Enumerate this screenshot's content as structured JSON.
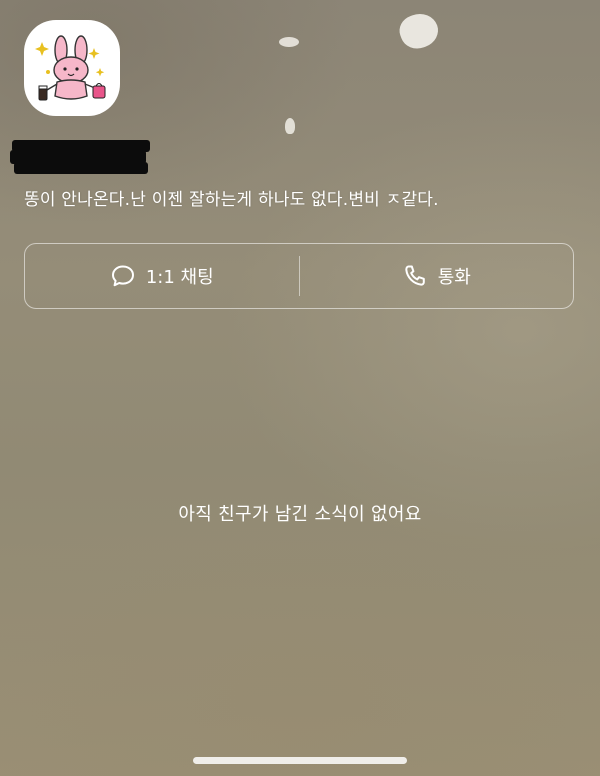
{
  "profile": {
    "avatar_icon": "pink-bunny-character-icon",
    "name_redacted": true,
    "status_message": "똥이 안나온다.난 이젠 잘하는게 하나도 없다.변비 ㅈ같다."
  },
  "actions": {
    "chat": {
      "icon": "speech-bubble-icon",
      "label": "1:1 채팅"
    },
    "call": {
      "icon": "phone-icon",
      "label": "통화"
    }
  },
  "feed": {
    "empty_message": "아직 친구가 남긴 소식이 없어요"
  },
  "colors": {
    "text": "#ffffff",
    "avatar_pink": "#f6b7c9",
    "redaction": "#0c0c0c"
  }
}
